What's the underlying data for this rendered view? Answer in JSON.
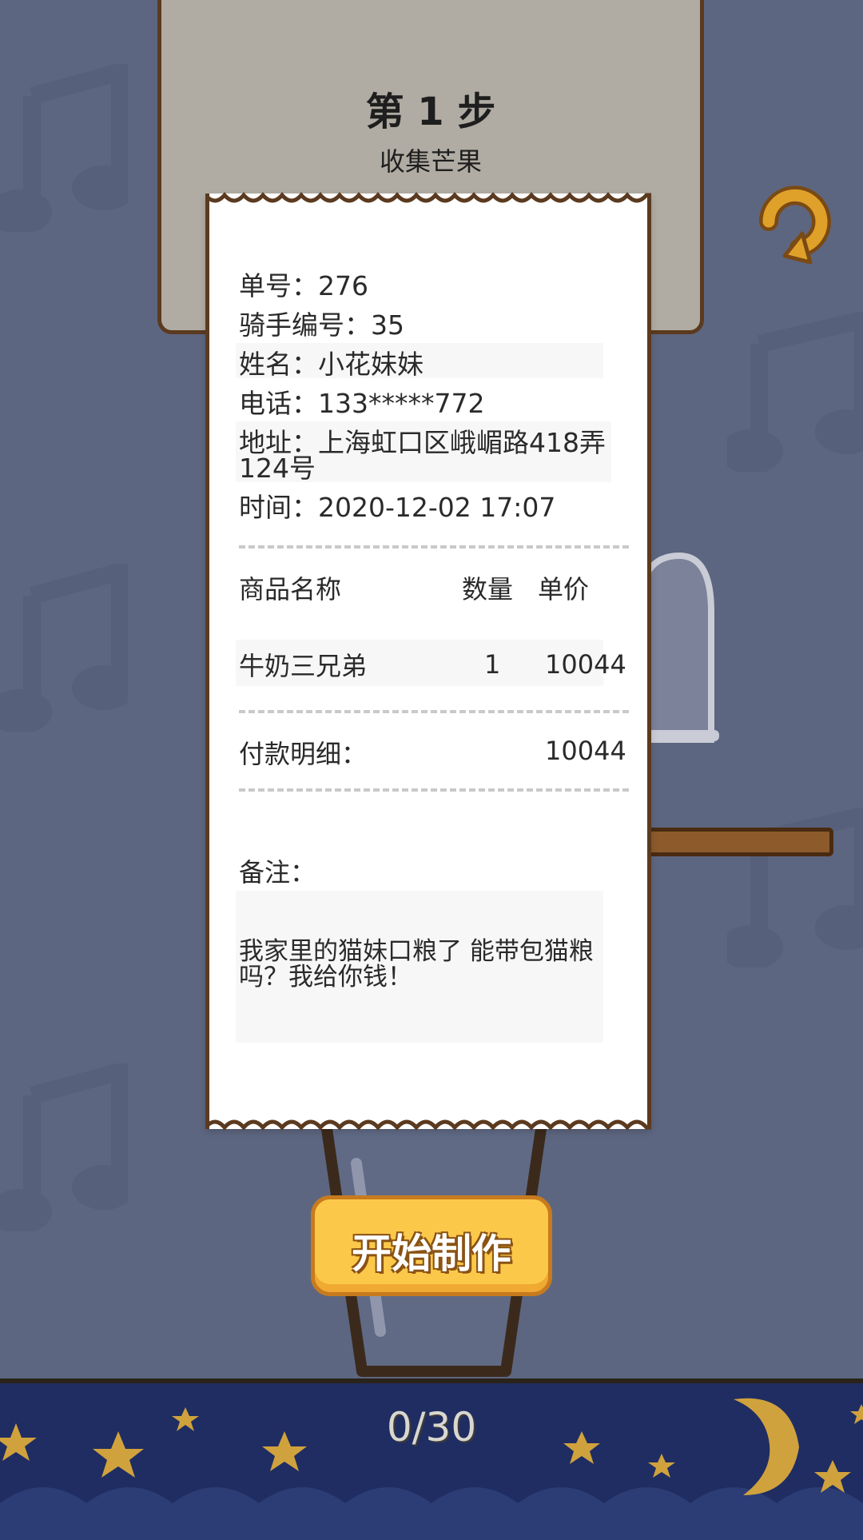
{
  "step": {
    "title": "第 1 步",
    "subtitle": "收集芒果"
  },
  "receipt": {
    "order_no": {
      "label": "单号：",
      "value": "276"
    },
    "rider_no": {
      "label": "骑手编号：",
      "value": "35"
    },
    "name": {
      "label": "姓名：",
      "value": "小花妹妹"
    },
    "phone": {
      "label": "电话：",
      "value": "133*****772"
    },
    "address": {
      "label": "地址：",
      "value": "上海虹口区峨嵋路418弄",
      "value_line2": "124号"
    },
    "time": {
      "label": "时间：",
      "value": "2020-12-02 17:07"
    },
    "columns": {
      "name": "商品名称",
      "qty": "数量",
      "price": "单价"
    },
    "items": [
      {
        "name": "牛奶三兄弟",
        "qty": "1",
        "price": "10044"
      }
    ],
    "payment": {
      "label": "付款明细：",
      "value": "10044"
    },
    "note": {
      "label": "备注：",
      "text": "我家里的猫妹口粮了 能带包猫粮吗？我给你钱！"
    }
  },
  "start_button": {
    "label": "开始制作"
  },
  "progress": {
    "text": "0/30"
  },
  "colors": {
    "background": "#5d6680",
    "card": "#b0aca3",
    "button": "#fcc84a",
    "band": "#1f2d62",
    "star": "#d0a23e"
  },
  "icons": [
    "refresh-icon",
    "music-note-icon",
    "star-icon",
    "moon-icon",
    "glass-dome-icon",
    "cup-icon"
  ]
}
